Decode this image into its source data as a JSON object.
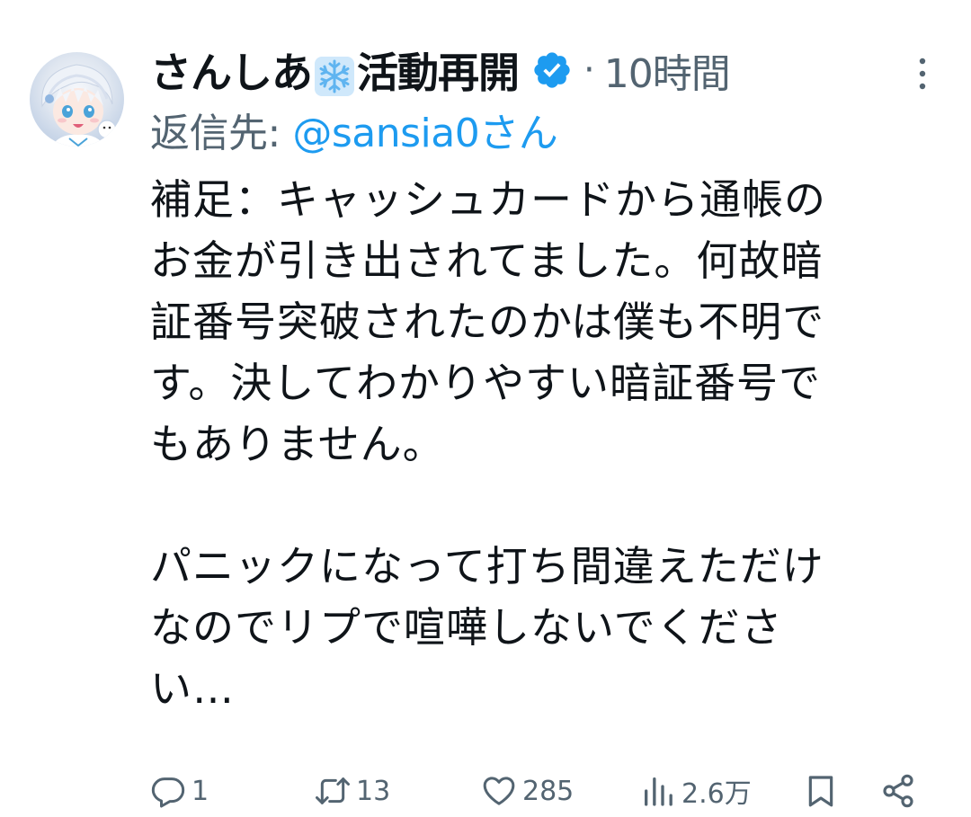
{
  "tweet": {
    "display_name": "さんしあ",
    "display_name_suffix": "活動再開",
    "name_emoji": "snowflake-emoji",
    "verified_badge": "verified-badge-icon",
    "separator": "·",
    "timestamp": "10時間",
    "reply_prefix": "返信先: ",
    "reply_handle": "@sansia0さん",
    "text": "補足：キャッシュカードから通帳の\nお金が引き出されてました。何故暗\n証番号突破されたのかは僕も不明で\nす。決してわかりやすい暗証番号で\nもありません。\n\nパニックになって打ち間違えただけ\nなのでリプで喧嘩しないでくださ\nい…"
  },
  "actions": {
    "reply": {
      "icon": "reply-icon",
      "count": "1"
    },
    "retweet": {
      "icon": "retweet-icon",
      "count": "13"
    },
    "like": {
      "icon": "heart-icon",
      "count": "285"
    },
    "views": {
      "icon": "views-chart-icon",
      "count": "2.6万"
    },
    "bookmark": {
      "icon": "bookmark-icon"
    },
    "share": {
      "icon": "share-icon"
    }
  },
  "colors": {
    "text_primary": "#0f1419",
    "text_secondary": "#536471",
    "accent_blue": "#1d9bf0"
  }
}
